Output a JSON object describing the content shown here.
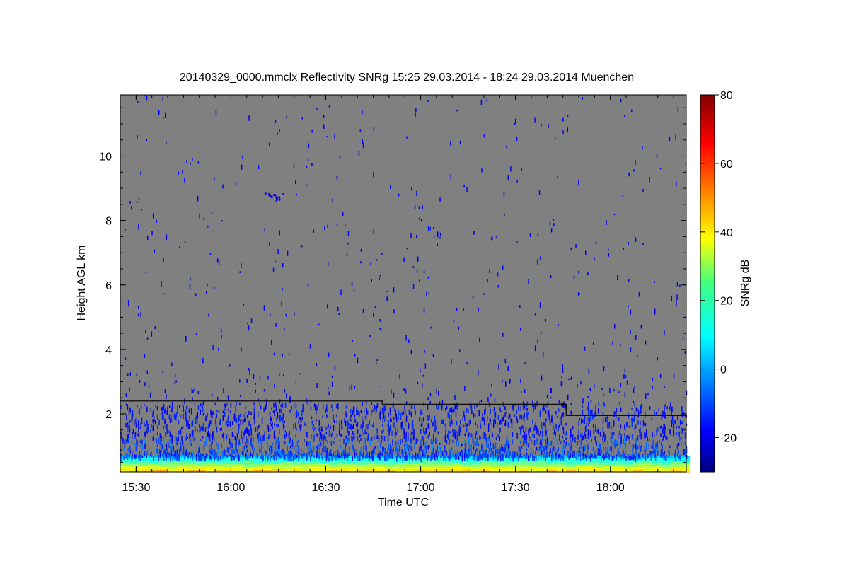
{
  "chart_data": {
    "type": "heatmap",
    "title": "20140329_0000.mmclx Reflectivity SNRg   15:25 29.03.2014 - 18:24 29.03.2014 Muenchen",
    "xlabel": "Time UTC",
    "ylabel": "Height AGL km",
    "colorbar_label": "SNRg dB",
    "x_ticks": [
      "15:30",
      "16:00",
      "16:30",
      "17:00",
      "17:30",
      "18:00"
    ],
    "x_tick_minutes": [
      930,
      960,
      990,
      1020,
      1050,
      1080
    ],
    "xlim_minutes": [
      925,
      1104
    ],
    "y_ticks": [
      2,
      4,
      6,
      8,
      10
    ],
    "ylim": [
      0.2,
      11.9
    ],
    "colorbar_ticks": [
      -20,
      0,
      20,
      40,
      60,
      80
    ],
    "colorbar_range": [
      -30,
      80
    ],
    "background_color": "#808080",
    "colormap": "jet",
    "line": {
      "description_times": [
        "15:25",
        "16:48",
        "16:48",
        "17:48",
        "17:48",
        "18:24"
      ],
      "minutes": [
        925,
        1008,
        1008,
        1066,
        1066,
        1104
      ],
      "height_km": [
        2.4,
        2.4,
        2.3,
        2.3,
        1.95,
        1.95
      ]
    },
    "features": [
      {
        "name": "surface_clutter_band",
        "height_km": [
          0.2,
          0.7
        ],
        "snr_db": [
          5,
          45
        ]
      },
      {
        "name": "noise_speckle_low",
        "height_km": [
          0.7,
          2.4
        ],
        "snr_db": [
          -20,
          -10
        ]
      },
      {
        "name": "noise_speckle_high",
        "height_km": [
          2.4,
          11.9
        ],
        "snr_db": [
          -20,
          -15
        ]
      },
      {
        "name": "small_echo",
        "time": "16:14",
        "height_km": 8.75,
        "snr_db": -20
      }
    ]
  }
}
